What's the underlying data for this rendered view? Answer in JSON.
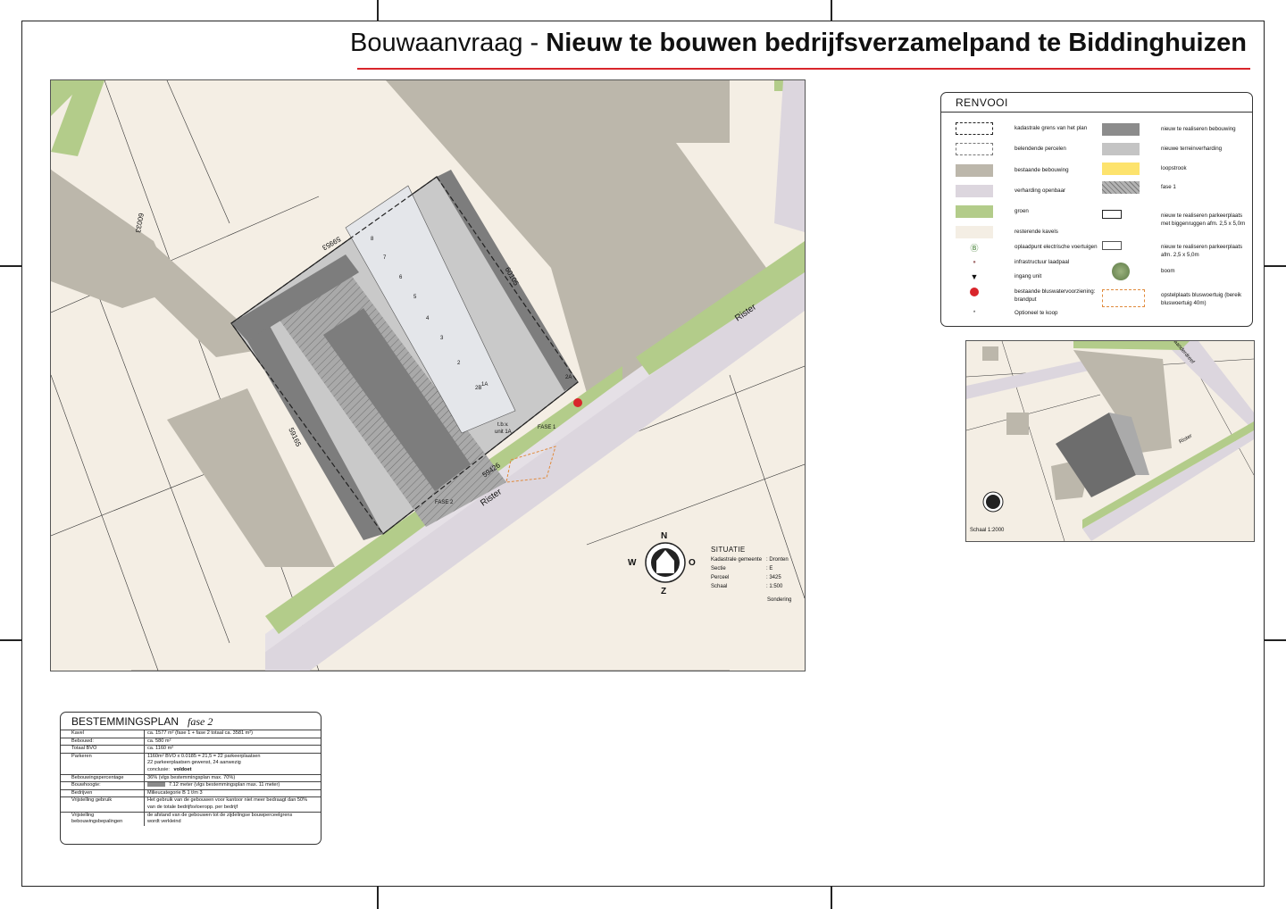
{
  "title": {
    "prefix": "Bouwaanvraag - ",
    "bold": "Nieuw te bouwen bedrijfsverzamelpand te Biddinghuizen"
  },
  "legend": {
    "heading": "RENVOOI",
    "left": [
      {
        "label": "kadastrale grens van het plan",
        "swatch": "dash"
      },
      {
        "label": "belendende percelen",
        "swatch": "dash-light"
      },
      {
        "label": "bestaande bebouwing",
        "swatch": "#bcb7ab"
      },
      {
        "label": "verharding openbaar",
        "swatch": "#dcd6de"
      },
      {
        "label": "groen",
        "swatch": "#b3cc8a"
      },
      {
        "label": "resterende kavels",
        "swatch": "#f4eee4"
      },
      {
        "label": "oplaadpunt electrische voertuigen",
        "swatch": "charger-icon"
      },
      {
        "label": "infrastructuur laadpaal",
        "swatch": "dot-icon"
      },
      {
        "label": "ingang unit",
        "swatch": "triangle-icon"
      },
      {
        "label": "bestaande bluswatervoorziening: brandput",
        "swatch": "hydrant-icon"
      },
      {
        "label": "Optioneel te koop",
        "swatch": "asterisk-icon"
      }
    ],
    "right": [
      {
        "label": "nieuw te realiseren bebouwing",
        "swatch": "#8c8c8c"
      },
      {
        "label": "nieuwe terreinverharding",
        "swatch": "#c4c4c4"
      },
      {
        "label": "loopstrook",
        "swatch": "#fde36d"
      },
      {
        "label": "fase 1",
        "swatch": "hatch"
      },
      {
        "label": "nieuw te realiseren parkeerplaats met biggenruggen afm. 2,5 x 5,0m",
        "swatch": "parking-bold"
      },
      {
        "label": "nieuw te realiseren parkeerplaats afm. 2,5 x 5,0m",
        "swatch": "parking"
      },
      {
        "label": "boom",
        "swatch": "tree-icon"
      },
      {
        "label": "opstelplaats bluswoertuig (bereik bluswoertuig 40m)",
        "swatch": "fire-area"
      }
    ]
  },
  "map": {
    "street": "Rister",
    "street2": "Rister",
    "plots": [
      "60033",
      "59953",
      "59165",
      "60105",
      "59426"
    ],
    "units_front": [
      "8",
      "7",
      "6",
      "5",
      "4",
      "3",
      "2",
      "2B",
      "2A"
    ],
    "unit_far": "1A",
    "tbd": [
      "t.b.v.",
      "unit 1A"
    ],
    "fase_labels": [
      "FASE 2",
      "FASE 1"
    ],
    "compass": {
      "n": "N",
      "w": "W",
      "o": "O",
      "z": "Z"
    },
    "sondering": "Sondering"
  },
  "situatie": {
    "heading": "SITUATIE",
    "rows": [
      {
        "k": "Kadastrale gemeente",
        "v": ": Dronten"
      },
      {
        "k": "Sectie",
        "v": ": E"
      },
      {
        "k": "Perceel",
        "v": ": 3425"
      },
      {
        "k": "Schaal",
        "v": ": 1:500"
      }
    ]
  },
  "inset": {
    "scale": "Schaal 1:2000",
    "street": "Rister",
    "street2": "Baanderdreef"
  },
  "bestemmingsplan": {
    "heading": "BESTEMMINGSPLAN",
    "phase": "fase 2",
    "rows": [
      {
        "k": "Kavel",
        "v": "ca. 1577 m² (fase 1 + fase 2 totaal ca. 3581 m²)"
      },
      {
        "k": "Bebouwd:",
        "v": "ca. 580 m²"
      },
      {
        "k": "Totaal BVO",
        "v": "ca. 1160 m²"
      },
      {
        "k": "Parkeren",
        "v": "1160m² BVO x 0.0185 = 21,5 = 22 parkeerplaatsen",
        "v2": "22 parkeerplaatsen gewenst, 24 aanwezig",
        "v3": "conclusie:",
        "v4": "voldoet"
      },
      {
        "k": "Bebouwingspercentage",
        "v": "36% (vlgs bestemmingsplan max. 70%)"
      },
      {
        "k": "Bouwhoogte:",
        "v": "7.12 meter (vlgs bestemmingsplan max. 11 meter)"
      },
      {
        "k": "Bedrijven",
        "v": "Milieucategorie B 1 t/m 3"
      },
      {
        "k": "Vrijstelling gebruik",
        "v": "Het gebruik van de gebouwen voor kantoor niet meer bedraagt dan 50%",
        "v2": "van de totale bedrijfsvloeropp. per bedrijf"
      },
      {
        "k": "Vrijstelling",
        "k2": "bebouwingsbepalingen",
        "v": "de afstand van de gebouwen tot de zijdelingse bouwperceelgrens",
        "v2": "wordt verkleind"
      }
    ]
  },
  "colors": {
    "accent": "#d9252b",
    "existing": "#bcb7ab",
    "green": "#b3cc8a",
    "road": "#dcd6de",
    "land": "#f4eee4",
    "new_building": "#8c8c8c"
  }
}
